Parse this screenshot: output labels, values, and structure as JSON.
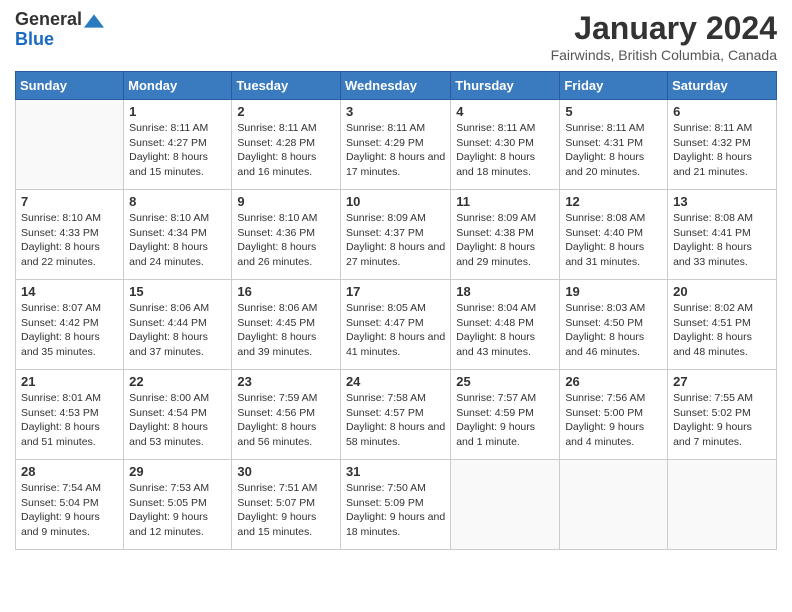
{
  "header": {
    "logo_general": "General",
    "logo_blue": "Blue",
    "month_title": "January 2024",
    "location": "Fairwinds, British Columbia, Canada"
  },
  "days_of_week": [
    "Sunday",
    "Monday",
    "Tuesday",
    "Wednesday",
    "Thursday",
    "Friday",
    "Saturday"
  ],
  "weeks": [
    [
      {
        "day": null,
        "sunrise": null,
        "sunset": null,
        "daylight": null
      },
      {
        "day": "1",
        "sunrise": "8:11 AM",
        "sunset": "4:27 PM",
        "daylight": "8 hours and 15 minutes."
      },
      {
        "day": "2",
        "sunrise": "8:11 AM",
        "sunset": "4:28 PM",
        "daylight": "8 hours and 16 minutes."
      },
      {
        "day": "3",
        "sunrise": "8:11 AM",
        "sunset": "4:29 PM",
        "daylight": "8 hours and 17 minutes."
      },
      {
        "day": "4",
        "sunrise": "8:11 AM",
        "sunset": "4:30 PM",
        "daylight": "8 hours and 18 minutes."
      },
      {
        "day": "5",
        "sunrise": "8:11 AM",
        "sunset": "4:31 PM",
        "daylight": "8 hours and 20 minutes."
      },
      {
        "day": "6",
        "sunrise": "8:11 AM",
        "sunset": "4:32 PM",
        "daylight": "8 hours and 21 minutes."
      }
    ],
    [
      {
        "day": "7",
        "sunrise": "8:10 AM",
        "sunset": "4:33 PM",
        "daylight": "8 hours and 22 minutes."
      },
      {
        "day": "8",
        "sunrise": "8:10 AM",
        "sunset": "4:34 PM",
        "daylight": "8 hours and 24 minutes."
      },
      {
        "day": "9",
        "sunrise": "8:10 AM",
        "sunset": "4:36 PM",
        "daylight": "8 hours and 26 minutes."
      },
      {
        "day": "10",
        "sunrise": "8:09 AM",
        "sunset": "4:37 PM",
        "daylight": "8 hours and 27 minutes."
      },
      {
        "day": "11",
        "sunrise": "8:09 AM",
        "sunset": "4:38 PM",
        "daylight": "8 hours and 29 minutes."
      },
      {
        "day": "12",
        "sunrise": "8:08 AM",
        "sunset": "4:40 PM",
        "daylight": "8 hours and 31 minutes."
      },
      {
        "day": "13",
        "sunrise": "8:08 AM",
        "sunset": "4:41 PM",
        "daylight": "8 hours and 33 minutes."
      }
    ],
    [
      {
        "day": "14",
        "sunrise": "8:07 AM",
        "sunset": "4:42 PM",
        "daylight": "8 hours and 35 minutes."
      },
      {
        "day": "15",
        "sunrise": "8:06 AM",
        "sunset": "4:44 PM",
        "daylight": "8 hours and 37 minutes."
      },
      {
        "day": "16",
        "sunrise": "8:06 AM",
        "sunset": "4:45 PM",
        "daylight": "8 hours and 39 minutes."
      },
      {
        "day": "17",
        "sunrise": "8:05 AM",
        "sunset": "4:47 PM",
        "daylight": "8 hours and 41 minutes."
      },
      {
        "day": "18",
        "sunrise": "8:04 AM",
        "sunset": "4:48 PM",
        "daylight": "8 hours and 43 minutes."
      },
      {
        "day": "19",
        "sunrise": "8:03 AM",
        "sunset": "4:50 PM",
        "daylight": "8 hours and 46 minutes."
      },
      {
        "day": "20",
        "sunrise": "8:02 AM",
        "sunset": "4:51 PM",
        "daylight": "8 hours and 48 minutes."
      }
    ],
    [
      {
        "day": "21",
        "sunrise": "8:01 AM",
        "sunset": "4:53 PM",
        "daylight": "8 hours and 51 minutes."
      },
      {
        "day": "22",
        "sunrise": "8:00 AM",
        "sunset": "4:54 PM",
        "daylight": "8 hours and 53 minutes."
      },
      {
        "day": "23",
        "sunrise": "7:59 AM",
        "sunset": "4:56 PM",
        "daylight": "8 hours and 56 minutes."
      },
      {
        "day": "24",
        "sunrise": "7:58 AM",
        "sunset": "4:57 PM",
        "daylight": "8 hours and 58 minutes."
      },
      {
        "day": "25",
        "sunrise": "7:57 AM",
        "sunset": "4:59 PM",
        "daylight": "9 hours and 1 minute."
      },
      {
        "day": "26",
        "sunrise": "7:56 AM",
        "sunset": "5:00 PM",
        "daylight": "9 hours and 4 minutes."
      },
      {
        "day": "27",
        "sunrise": "7:55 AM",
        "sunset": "5:02 PM",
        "daylight": "9 hours and 7 minutes."
      }
    ],
    [
      {
        "day": "28",
        "sunrise": "7:54 AM",
        "sunset": "5:04 PM",
        "daylight": "9 hours and 9 minutes."
      },
      {
        "day": "29",
        "sunrise": "7:53 AM",
        "sunset": "5:05 PM",
        "daylight": "9 hours and 12 minutes."
      },
      {
        "day": "30",
        "sunrise": "7:51 AM",
        "sunset": "5:07 PM",
        "daylight": "9 hours and 15 minutes."
      },
      {
        "day": "31",
        "sunrise": "7:50 AM",
        "sunset": "5:09 PM",
        "daylight": "9 hours and 18 minutes."
      },
      {
        "day": null,
        "sunrise": null,
        "sunset": null,
        "daylight": null
      },
      {
        "day": null,
        "sunrise": null,
        "sunset": null,
        "daylight": null
      },
      {
        "day": null,
        "sunrise": null,
        "sunset": null,
        "daylight": null
      }
    ]
  ],
  "labels": {
    "sunrise_prefix": "Sunrise: ",
    "sunset_prefix": "Sunset: ",
    "daylight_prefix": "Daylight: "
  }
}
